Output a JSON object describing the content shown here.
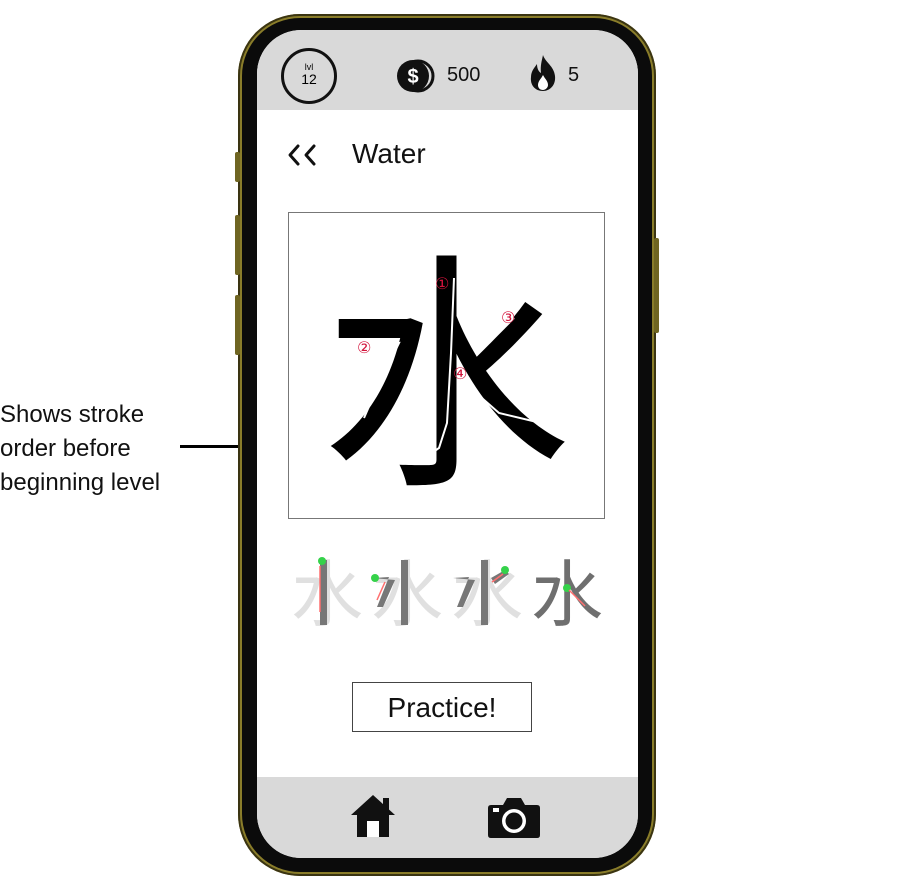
{
  "annotation": {
    "lines": [
      "Shows stroke",
      "order before",
      "beginning level"
    ]
  },
  "status": {
    "level_label": "lvl",
    "level_value": "12",
    "coins": "500",
    "streak": "5"
  },
  "header": {
    "back_label": "<<",
    "title": "Water"
  },
  "character": {
    "glyph": "水",
    "stroke_numbers": [
      "①",
      "②",
      "③",
      "④"
    ],
    "stroke_steps": [
      "水",
      "水",
      "水",
      "水"
    ]
  },
  "practice_label": "Practice!",
  "nav": {
    "items": [
      "home-icon",
      "camera-icon"
    ]
  },
  "colors": {
    "bar_gray": "#d9d9d9",
    "phone_frame": "#8a7d2a",
    "stroke_number_red": "#d2143c",
    "stroke_start_green": "#35d24a"
  }
}
